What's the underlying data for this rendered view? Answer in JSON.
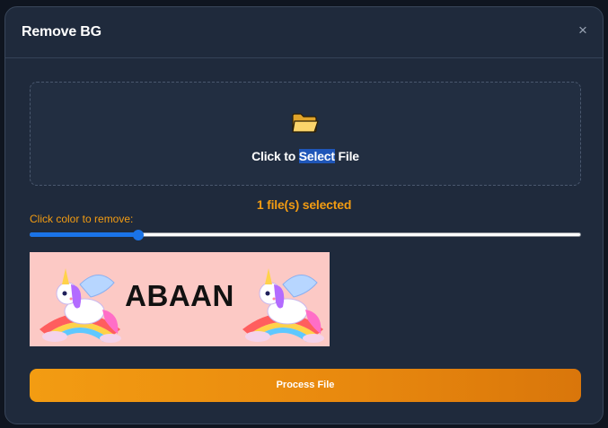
{
  "modal": {
    "title": "Remove BG",
    "close_glyph": "×"
  },
  "dropzone": {
    "icon": "folder-open-icon",
    "text_before": "Click to ",
    "text_highlight": "Select",
    "text_after": " File"
  },
  "files_status": "1 file(s) selected",
  "color_picker": {
    "label": "Click color to remove:",
    "slider_value_fraction": 0.197
  },
  "preview": {
    "text": "ABAAN",
    "background_color": "#fcc9c5"
  },
  "process_button": {
    "label": "Process File"
  },
  "colors": {
    "accent": "#f39c12",
    "slider": "#1a73e8",
    "modal_bg": "#1f2a3c"
  }
}
